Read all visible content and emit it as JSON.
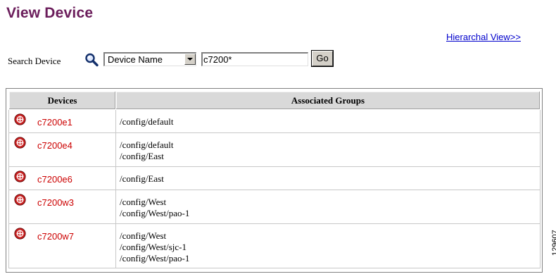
{
  "page": {
    "title": "View Device",
    "hierarchical_link": "Hierarchal View>>",
    "figure_number": "129607"
  },
  "search": {
    "label": "Search Device",
    "icon": "magnifier-icon",
    "field_selected": "Device Name",
    "value": "c7200*",
    "go_label": "Go"
  },
  "table": {
    "headers": [
      "Devices",
      "Associated Groups"
    ],
    "rows": [
      {
        "icon": "router-icon",
        "device": "c7200e1",
        "groups": [
          "/config/default"
        ]
      },
      {
        "icon": "router-icon",
        "device": "c7200e4",
        "groups": [
          "/config/default",
          "/config/East"
        ]
      },
      {
        "icon": "router-icon",
        "device": "c7200e6",
        "groups": [
          "/config/East"
        ]
      },
      {
        "icon": "router-icon",
        "device": "c7200w3",
        "groups": [
          "/config/West",
          "/config/West/pao-1"
        ]
      },
      {
        "icon": "router-icon",
        "device": "c7200w7",
        "groups": [
          "/config/West",
          "/config/West/sjc-1",
          "/config/West/pao-1"
        ]
      }
    ]
  },
  "colors": {
    "title": "#6b1d5b",
    "link": "#0000cc",
    "device_name": "#cc0000",
    "header_bg": "#d9d9d9",
    "router_icon": "#cc2222"
  }
}
